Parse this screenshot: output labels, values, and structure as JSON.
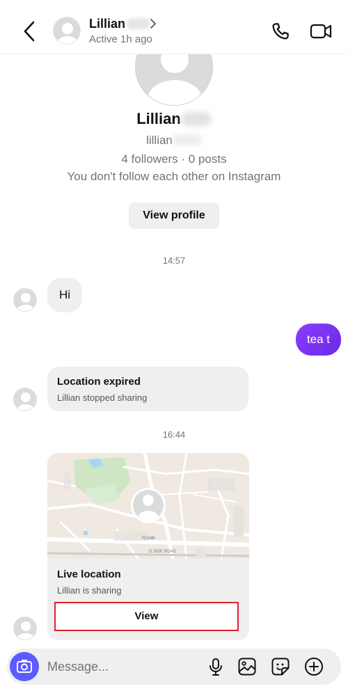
{
  "header": {
    "name": "Lillian",
    "status": "Active 1h ago"
  },
  "profile": {
    "name": "Lillian",
    "username": "lillian",
    "stats": "4 followers · 0 posts",
    "note": "You don't follow each other on Instagram",
    "view_profile_label": "View profile"
  },
  "thread": {
    "timestamp_1": "14:57",
    "msg_hi": "Hi",
    "msg_out": "tea t",
    "location_expired": {
      "title": "Location expired",
      "subtitle": "Lillian stopped sharing"
    },
    "timestamp_2": "16:44",
    "live_location": {
      "title": "Live location",
      "subtitle": "Lillian is sharing",
      "view_label": "View",
      "map_labels": [
        "ROAD",
        "D SIDE ROAD"
      ]
    }
  },
  "composer": {
    "placeholder": "Message..."
  },
  "colors": {
    "outgoing_bubble": "#7b2ff7",
    "camera_button": "#5b5bff",
    "highlight_box": "#e0212d"
  }
}
